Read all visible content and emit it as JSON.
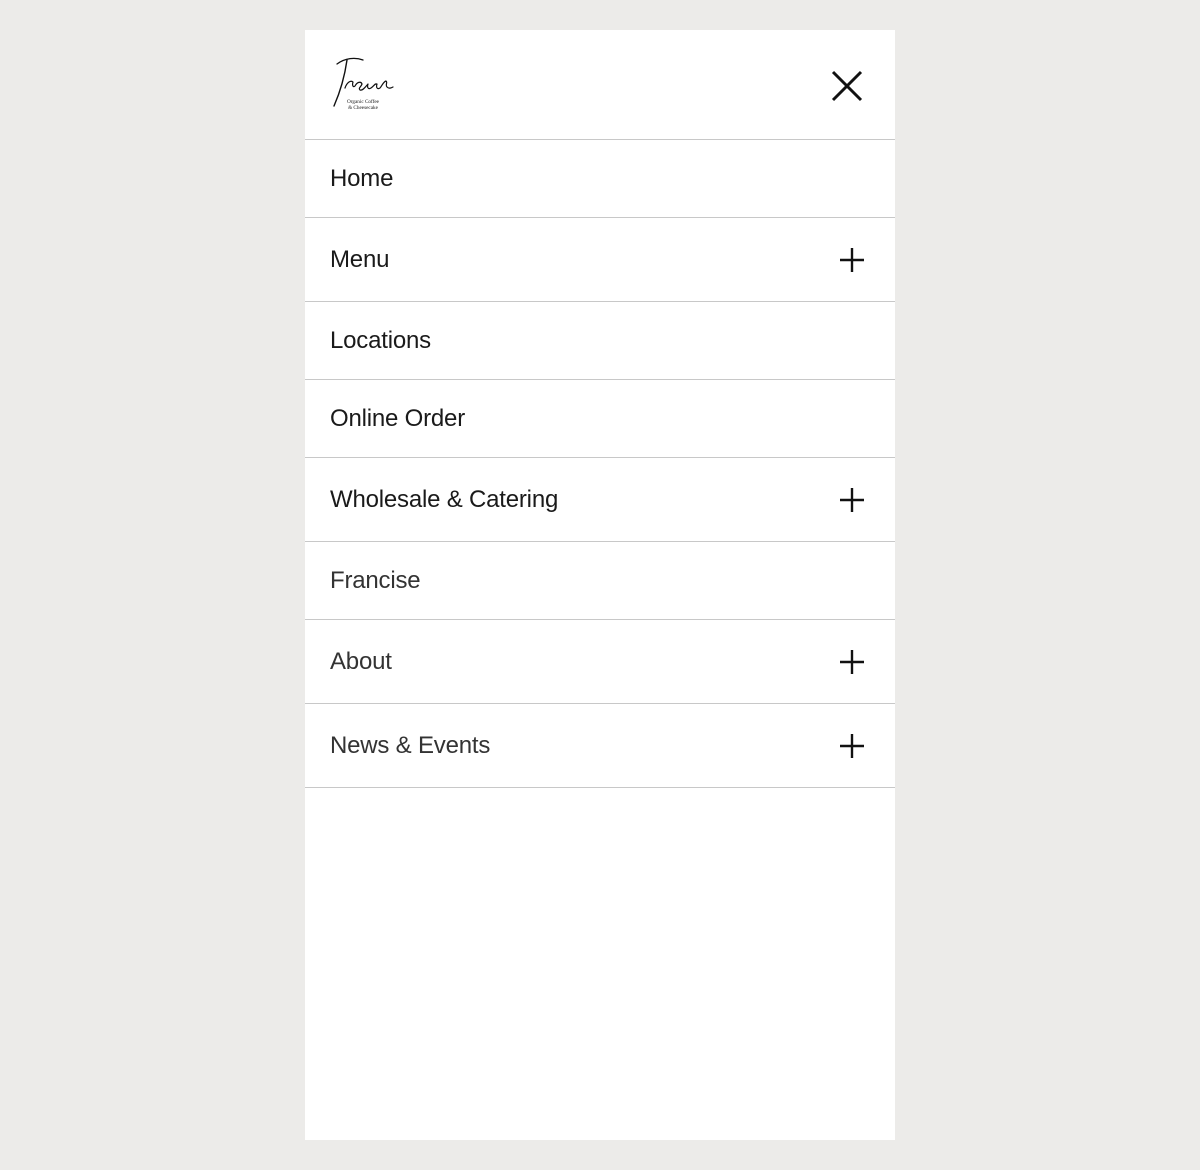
{
  "brand": {
    "name": "Trees",
    "tagline_line1": "Organic Coffee",
    "tagline_line2": "& Cheesecake"
  },
  "header": {
    "close_icon": "close-icon"
  },
  "nav": {
    "items": [
      {
        "label": "Home",
        "expandable": false
      },
      {
        "label": "Menu",
        "expandable": true,
        "icon": "plus-icon"
      },
      {
        "label": "Locations",
        "expandable": false
      },
      {
        "label": "Online Order",
        "expandable": false
      },
      {
        "label": "Wholesale & Catering",
        "expandable": true,
        "icon": "plus-icon"
      },
      {
        "label": "Francise",
        "expandable": false
      },
      {
        "label": "About",
        "expandable": true,
        "icon": "plus-icon"
      },
      {
        "label": "News & Events",
        "expandable": true,
        "icon": "plus-icon"
      }
    ]
  },
  "colors": {
    "background": "#ecebe9",
    "panel": "#ffffff",
    "divider": "#c8c8c8",
    "text": "#1a1a1a",
    "icon": "#111111"
  }
}
